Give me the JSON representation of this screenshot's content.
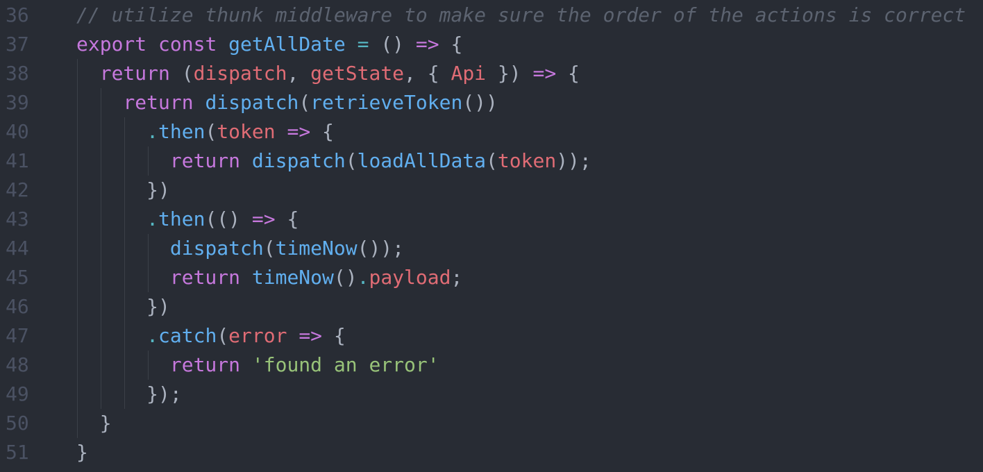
{
  "colors": {
    "background": "#282c34",
    "line_number": "#4b5263",
    "comment": "#5c6370",
    "keyword": "#c678dd",
    "function": "#61afef",
    "operator": "#56b6c2",
    "variable": "#e06c75",
    "string": "#98c379",
    "punctuation": "#abb2bf",
    "indent_guide": "#3b4048"
  },
  "editor": {
    "lines": [
      {
        "number": "36",
        "tokens": [
          {
            "text": "// utilize thunk middleware to make sure the order of the actions is correct",
            "type": "comment"
          }
        ]
      },
      {
        "number": "37",
        "tokens": [
          {
            "text": "export",
            "type": "keyword"
          },
          {
            "text": " ",
            "type": "punct"
          },
          {
            "text": "const",
            "type": "keyword"
          },
          {
            "text": " ",
            "type": "punct"
          },
          {
            "text": "getAllDate",
            "type": "function"
          },
          {
            "text": " ",
            "type": "punct"
          },
          {
            "text": "=",
            "type": "operator"
          },
          {
            "text": " () ",
            "type": "punct"
          },
          {
            "text": "=>",
            "type": "keyword"
          },
          {
            "text": " {",
            "type": "punct"
          }
        ]
      },
      {
        "number": "38",
        "tokens": [
          {
            "text": "  ",
            "type": "punct"
          },
          {
            "text": "return",
            "type": "keyword"
          },
          {
            "text": " (",
            "type": "punct"
          },
          {
            "text": "dispatch",
            "type": "variable"
          },
          {
            "text": ", ",
            "type": "punct"
          },
          {
            "text": "getState",
            "type": "variable"
          },
          {
            "text": ", { ",
            "type": "punct"
          },
          {
            "text": "Api",
            "type": "variable"
          },
          {
            "text": " }) ",
            "type": "punct"
          },
          {
            "text": "=>",
            "type": "keyword"
          },
          {
            "text": " {",
            "type": "punct"
          }
        ]
      },
      {
        "number": "39",
        "tokens": [
          {
            "text": "    ",
            "type": "punct"
          },
          {
            "text": "return",
            "type": "keyword"
          },
          {
            "text": " ",
            "type": "punct"
          },
          {
            "text": "dispatch",
            "type": "function"
          },
          {
            "text": "(",
            "type": "punct"
          },
          {
            "text": "retrieveToken",
            "type": "function"
          },
          {
            "text": "())",
            "type": "punct"
          }
        ]
      },
      {
        "number": "40",
        "tokens": [
          {
            "text": "      ",
            "type": "punct"
          },
          {
            "text": ".",
            "type": "operator"
          },
          {
            "text": "then",
            "type": "function"
          },
          {
            "text": "(",
            "type": "punct"
          },
          {
            "text": "token",
            "type": "variable"
          },
          {
            "text": " ",
            "type": "punct"
          },
          {
            "text": "=>",
            "type": "keyword"
          },
          {
            "text": " {",
            "type": "punct"
          }
        ]
      },
      {
        "number": "41",
        "tokens": [
          {
            "text": "        ",
            "type": "punct"
          },
          {
            "text": "return",
            "type": "keyword"
          },
          {
            "text": " ",
            "type": "punct"
          },
          {
            "text": "dispatch",
            "type": "function"
          },
          {
            "text": "(",
            "type": "punct"
          },
          {
            "text": "loadAllData",
            "type": "function"
          },
          {
            "text": "(",
            "type": "punct"
          },
          {
            "text": "token",
            "type": "variable"
          },
          {
            "text": "));",
            "type": "punct"
          }
        ]
      },
      {
        "number": "42",
        "tokens": [
          {
            "text": "      })",
            "type": "punct"
          }
        ]
      },
      {
        "number": "43",
        "tokens": [
          {
            "text": "      ",
            "type": "punct"
          },
          {
            "text": ".",
            "type": "operator"
          },
          {
            "text": "then",
            "type": "function"
          },
          {
            "text": "(() ",
            "type": "punct"
          },
          {
            "text": "=>",
            "type": "keyword"
          },
          {
            "text": " {",
            "type": "punct"
          }
        ]
      },
      {
        "number": "44",
        "tokens": [
          {
            "text": "        ",
            "type": "punct"
          },
          {
            "text": "dispatch",
            "type": "function"
          },
          {
            "text": "(",
            "type": "punct"
          },
          {
            "text": "timeNow",
            "type": "function"
          },
          {
            "text": "());",
            "type": "punct"
          }
        ]
      },
      {
        "number": "45",
        "tokens": [
          {
            "text": "        ",
            "type": "punct"
          },
          {
            "text": "return",
            "type": "keyword"
          },
          {
            "text": " ",
            "type": "punct"
          },
          {
            "text": "timeNow",
            "type": "function"
          },
          {
            "text": "()",
            "type": "punct"
          },
          {
            "text": ".",
            "type": "operator"
          },
          {
            "text": "payload",
            "type": "variable"
          },
          {
            "text": ";",
            "type": "punct"
          }
        ]
      },
      {
        "number": "46",
        "tokens": [
          {
            "text": "      })",
            "type": "punct"
          }
        ]
      },
      {
        "number": "47",
        "tokens": [
          {
            "text": "      ",
            "type": "punct"
          },
          {
            "text": ".",
            "type": "operator"
          },
          {
            "text": "catch",
            "type": "function"
          },
          {
            "text": "(",
            "type": "punct"
          },
          {
            "text": "error",
            "type": "variable"
          },
          {
            "text": " ",
            "type": "punct"
          },
          {
            "text": "=>",
            "type": "keyword"
          },
          {
            "text": " {",
            "type": "punct"
          }
        ]
      },
      {
        "number": "48",
        "tokens": [
          {
            "text": "        ",
            "type": "punct"
          },
          {
            "text": "return",
            "type": "keyword"
          },
          {
            "text": " ",
            "type": "punct"
          },
          {
            "text": "'found an error'",
            "type": "string"
          }
        ]
      },
      {
        "number": "49",
        "tokens": [
          {
            "text": "      });",
            "type": "punct"
          }
        ]
      },
      {
        "number": "50",
        "tokens": [
          {
            "text": "  }",
            "type": "punct"
          }
        ]
      },
      {
        "number": "51",
        "tokens": [
          {
            "text": "}",
            "type": "punct"
          }
        ]
      }
    ]
  }
}
